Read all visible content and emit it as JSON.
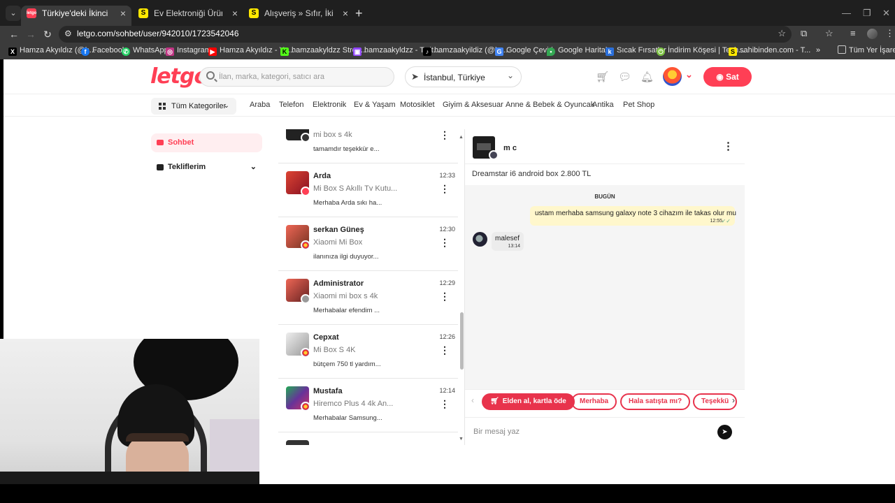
{
  "browser": {
    "tabs": [
      {
        "title": "Türkiye'deki İkinci El Eşyaları Al",
        "favicon": "letgo",
        "active": true
      },
      {
        "title": "Ev Elektroniği Ürünleri & Fiyatla",
        "favicon": "S",
        "active": false
      },
      {
        "title": "Alışveriş » Sıfır, İkinci El Ürünleri",
        "favicon": "S",
        "active": false
      }
    ],
    "new_tab": "+",
    "url": "letgo.com/sohbet/user/942010/1723542046",
    "bookmarks": [
      "Hamza Akyıldız (@h...",
      "Facebook",
      "WhatsApp",
      "Instagram",
      "Hamza Akyıldız - Yo...",
      "hamzaakyldzz Strea...",
      "hamzaakyldzz - Twit...",
      "hamzaakyildiz (@ha...",
      "Google Çeviri",
      "Google Haritalar",
      "Sıcak Fırsatlar",
      "İndirim Köşesi | Tech...",
      "sahibinden.com - T..."
    ],
    "bookmarks_more": "»",
    "all_bookmarks": "Tüm Yer İşaretleri"
  },
  "site": {
    "logo": "letgo",
    "search_placeholder": "İlan, marka, kategori, satıcı ara",
    "location": "İstanbul, Türkiye",
    "sell_label": "Sat",
    "all_categories": "Tüm Kategoriler",
    "categories": [
      "Araba",
      "Telefon",
      "Elektronik",
      "Ev & Yaşam",
      "Motosiklet",
      "Giyim & Aksesuar",
      "Anne & Bebek & Oyuncak",
      "Antika",
      "Pet Shop"
    ]
  },
  "sidebar": {
    "chat_label": "Sohbet",
    "offers_label": "Tekliflerim"
  },
  "conversations": [
    {
      "name": "",
      "time": "",
      "product": "mi box s 4k",
      "message": "tamamdır teşekkür e..."
    },
    {
      "name": "Arda",
      "time": "12:33",
      "product": "Mi Box S Akıllı Tv Kutu...",
      "message": "Merhaba Arda sıkı ha..."
    },
    {
      "name": "serkan Güneş",
      "time": "12:30",
      "product": "Xiaomi Mi Box",
      "message": "ilanınıza ilgi duyuyor..."
    },
    {
      "name": "Administrator",
      "time": "12:29",
      "product": "Xiaomi mi box s 4k",
      "message": "Merhabalar efendim ..."
    },
    {
      "name": "Cepxat",
      "time": "12:26",
      "product": "Mi Box S 4K",
      "message": "bütçem 750 tl yardım..."
    },
    {
      "name": "Mustafa",
      "time": "12:14",
      "product": "Hiremco Plus 4 4k An...",
      "message": "Merhabalar Samsung..."
    }
  ],
  "chat": {
    "user_name": "m c",
    "product_title": "Dreamstar i6 android box",
    "product_price": "2.800 TL",
    "day_label": "BUGÜN",
    "outgoing": {
      "text": "ustam merhaba samsung galaxy note 3 cihazım ile takas olur mu",
      "time": "12:55"
    },
    "incoming": {
      "text": "malesef",
      "time": "13:14"
    },
    "quick_replies": [
      "Elden al, kartla öde",
      "Merhaba",
      "Hala satışta mı?",
      "Teşekkü"
    ],
    "input_placeholder": "Bir mesaj yaz"
  },
  "colors": {
    "brand": "#ff3f55",
    "quick_reply": "#e8334c",
    "outgoing_bubble": "#fff7cc"
  }
}
